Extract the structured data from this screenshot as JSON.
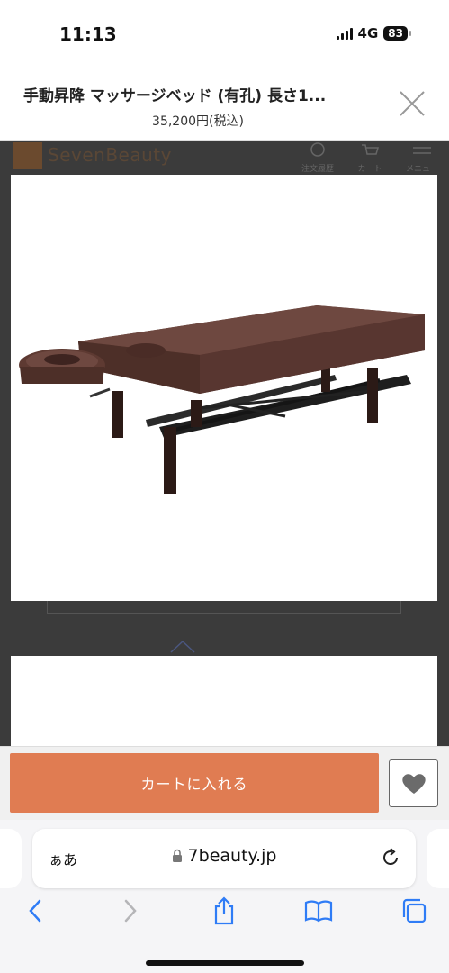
{
  "status_bar": {
    "time": "11:13",
    "network": "4G",
    "battery": "83"
  },
  "sheet": {
    "title": "手動昇降 マッサージベッド (有孔) 長さ1...",
    "price": "35,200円(税込)"
  },
  "site_header": {
    "logo_text": "SevenBeauty",
    "items": [
      {
        "label": "注文履歴"
      },
      {
        "label": "カート"
      },
      {
        "label": "メニュー"
      }
    ]
  },
  "cart_bar": {
    "add_to_cart_label": "カートに入れる"
  },
  "browser": {
    "text_size_label": "ぁあ",
    "url": "7beauty.jp"
  },
  "colors": {
    "accent": "#e07c52",
    "bed_leather": "#5e3a32",
    "overlay": "#3b3b3b"
  },
  "icons": {
    "close": "close-icon",
    "favorite": "heart-icon",
    "lock": "lock-icon",
    "reload": "reload-icon",
    "back": "chevron-left-icon",
    "forward": "chevron-right-icon",
    "share": "share-icon",
    "bookmarks": "book-icon",
    "tabs": "tabs-icon"
  }
}
